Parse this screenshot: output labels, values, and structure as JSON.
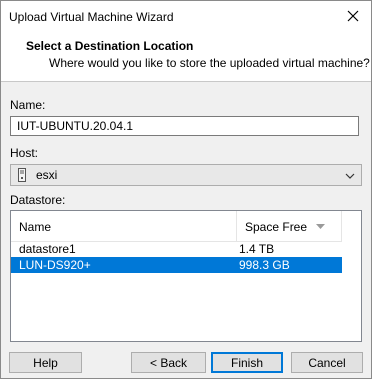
{
  "window": {
    "title": "Upload Virtual Machine Wizard"
  },
  "header": {
    "title": "Select a Destination Location",
    "subtitle": "Where would you like to store the uploaded virtual machine?"
  },
  "form": {
    "name_label": "Name:",
    "name_value": "IUT-UBUNTU.20.04.1",
    "host_label": "Host:",
    "host_value": "esxi",
    "datastore_label": "Datastore:"
  },
  "datastore_table": {
    "columns": [
      "Name",
      "Space Free"
    ],
    "rows": [
      {
        "name": "datastore1",
        "space": "1.4 TB",
        "selected": false
      },
      {
        "name": "LUN-DS920+",
        "space": "998.3 GB",
        "selected": true
      }
    ]
  },
  "buttons": {
    "help": "Help",
    "back": "< Back",
    "finish": "Finish",
    "cancel": "Cancel"
  },
  "colors": {
    "selection": "#0078d7",
    "button_face": "#e1e1e1",
    "dialog_bg": "#f0f0f0"
  },
  "icons": {
    "close": "close-icon",
    "host": "server-icon",
    "dropdown": "chevron-down-icon",
    "sort": "sort-desc-icon"
  }
}
